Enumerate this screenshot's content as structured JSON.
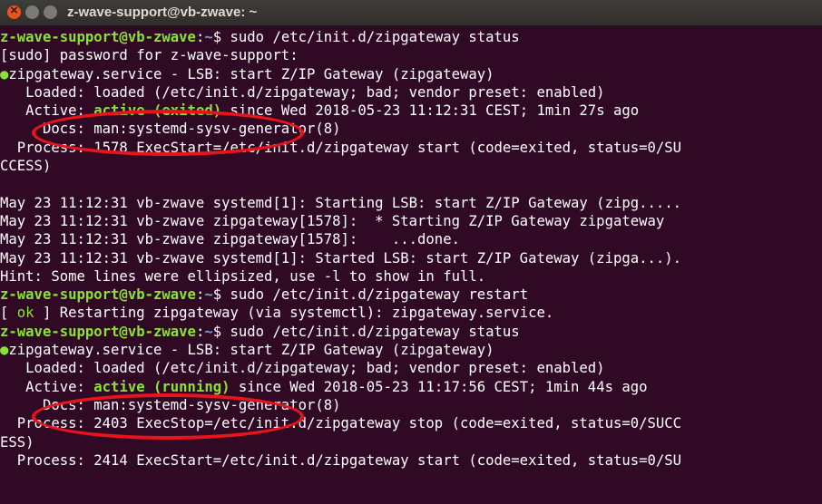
{
  "window": {
    "title": "z-wave-support@vb-zwave: ~"
  },
  "terminal": {
    "lines": [
      {
        "kind": "prompt",
        "user": "z-wave-support@vb-zwave",
        "sep": ":",
        "path": "~",
        "sym": "$",
        "cmd": " sudo /etc/init.d/zipgateway status"
      },
      {
        "kind": "plain",
        "text": "[sudo] password for z-wave-support:"
      },
      {
        "kind": "service",
        "dot": "●",
        "text": "zipgateway.service - LSB: start Z/IP Gateway (zipgateway)"
      },
      {
        "kind": "plain",
        "text": "   Loaded: loaded (/etc/init.d/zipgateway; bad; vendor preset: enabled)"
      },
      {
        "kind": "active",
        "pre": "   Active: ",
        "status": "active (exited)",
        "post": " since Wed 2018-05-23 11:12:31 CEST; 1min 27s ago"
      },
      {
        "kind": "plain",
        "text": "     Docs: man:systemd-sysv-generator(8)"
      },
      {
        "kind": "plain",
        "text": "  Process: 1578 ExecStart=/etc/init.d/zipgateway start (code=exited, status=0/SU"
      },
      {
        "kind": "plain",
        "text": "CCESS)"
      },
      {
        "kind": "plain",
        "text": ""
      },
      {
        "kind": "plain",
        "text": "May 23 11:12:31 vb-zwave systemd[1]: Starting LSB: start Z/IP Gateway (zipg....."
      },
      {
        "kind": "plain",
        "text": "May 23 11:12:31 vb-zwave zipgateway[1578]:  * Starting Z/IP Gateway zipgateway"
      },
      {
        "kind": "plain",
        "text": "May 23 11:12:31 vb-zwave zipgateway[1578]:    ...done."
      },
      {
        "kind": "plain",
        "text": "May 23 11:12:31 vb-zwave systemd[1]: Started LSB: start Z/IP Gateway (zipga...)."
      },
      {
        "kind": "plain",
        "text": "Hint: Some lines were ellipsized, use -l to show in full."
      },
      {
        "kind": "prompt",
        "user": "z-wave-support@vb-zwave",
        "sep": ":",
        "path": "~",
        "sym": "$",
        "cmd": " sudo /etc/init.d/zipgateway restart"
      },
      {
        "kind": "ok",
        "open": "[ ",
        "ok": "ok",
        "close": " ] ",
        "text": "Restarting zipgateway (via systemctl): zipgateway.service."
      },
      {
        "kind": "prompt",
        "user": "z-wave-support@vb-zwave",
        "sep": ":",
        "path": "~",
        "sym": "$",
        "cmd": " sudo /etc/init.d/zipgateway status"
      },
      {
        "kind": "service",
        "dot": "●",
        "text": "zipgateway.service - LSB: start Z/IP Gateway (zipgateway)"
      },
      {
        "kind": "plain",
        "text": "   Loaded: loaded (/etc/init.d/zipgateway; bad; vendor preset: enabled)"
      },
      {
        "kind": "active",
        "pre": "   Active: ",
        "status": "active (running)",
        "post": " since Wed 2018-05-23 11:17:56 CEST; 1min 44s ago"
      },
      {
        "kind": "plain",
        "text": "     Docs: man:systemd-sysv-generator(8)"
      },
      {
        "kind": "plain",
        "text": "  Process: 2403 ExecStop=/etc/init.d/zipgateway stop (code=exited, status=0/SUCC"
      },
      {
        "kind": "plain",
        "text": "ESS)"
      },
      {
        "kind": "plain",
        "text": "  Process: 2414 ExecStart=/etc/init.d/zipgateway start (code=exited, status=0/SU"
      }
    ]
  },
  "colors": {
    "background": "#300a24",
    "prompt_green": "#8ae234",
    "path_blue": "#729fcf",
    "annotation_red": "#e8141b"
  }
}
